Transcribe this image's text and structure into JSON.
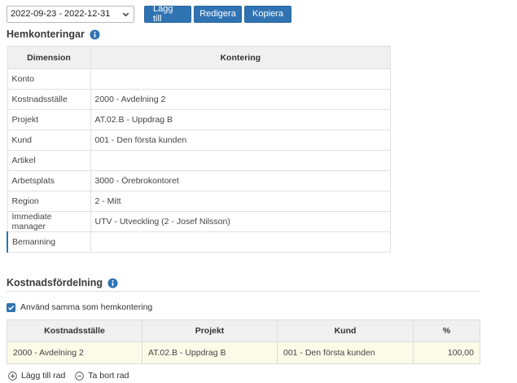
{
  "toolbar": {
    "period_value": "2022-09-23 - 2022-12-31",
    "add_label": "Lägg till",
    "edit_label": "Redigera",
    "copy_label": "Kopiera"
  },
  "home": {
    "title": "Hemkonteringar",
    "columns": [
      "Dimension",
      "Kontering"
    ],
    "rows": [
      {
        "dimension": "Konto",
        "value": ""
      },
      {
        "dimension": "Kostnadsställe",
        "value": "2000 - Avdelning 2"
      },
      {
        "dimension": "Projekt",
        "value": "AT.02.B - Uppdrag B"
      },
      {
        "dimension": "Kund",
        "value": "001 - Den första kunden"
      },
      {
        "dimension": "Artikel",
        "value": ""
      },
      {
        "dimension": "Arbetsplats",
        "value": "3000 - Örebrokontoret"
      },
      {
        "dimension": "Region",
        "value": "2 - Mitt"
      },
      {
        "dimension": "Immediate manager",
        "value": "UTV - Utveckling (2 - Josef Nilsson)"
      },
      {
        "dimension": "Bemanning",
        "value": ""
      }
    ]
  },
  "cost": {
    "title": "Kostnadsfördelning",
    "same_as_home_label": "Använd samma som hemkontering",
    "same_as_home_checked": true,
    "columns": [
      "Kostnadsställe",
      "Projekt",
      "Kund",
      "%"
    ],
    "rows": [
      {
        "cost_center": "2000 - Avdelning 2",
        "project": "AT.02.B - Uppdrag B",
        "customer": "001 - Den första kunden",
        "percent": "100,00"
      }
    ],
    "add_row_label": "Lägg till rad",
    "remove_row_label": "Ta bort rad"
  },
  "icons": {
    "info": "info-icon",
    "dropdown": "chevron-down-icon",
    "add": "plus-circle-icon",
    "remove": "minus-circle-icon",
    "check": "check-icon"
  },
  "colors": {
    "accent": "#2f73b3",
    "selected_row_bg": "#fbfbe8",
    "header_bg": "#f0f0f0"
  }
}
